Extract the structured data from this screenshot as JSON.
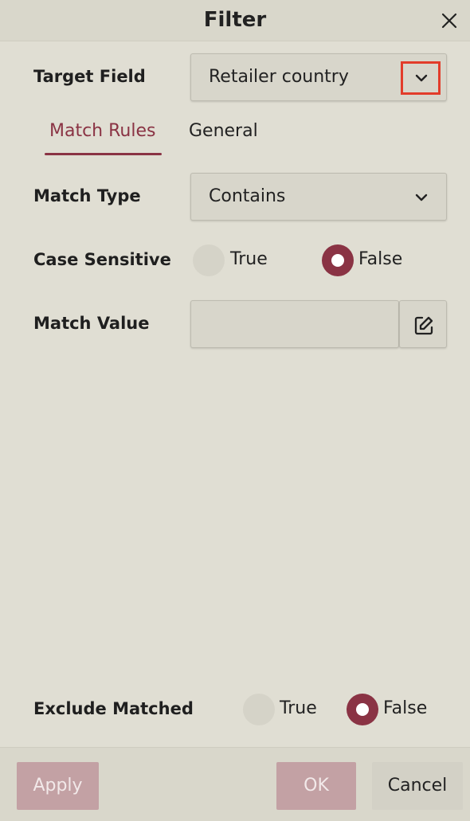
{
  "dialog": {
    "title": "Filter",
    "close_icon": "close-icon"
  },
  "target_field": {
    "label": "Target Field",
    "value": "Retailer country",
    "dropdown_icon": "chevron-down-icon"
  },
  "tabs": [
    {
      "label": "Match Rules",
      "active": true
    },
    {
      "label": "General",
      "active": false
    }
  ],
  "match_type": {
    "label": "Match Type",
    "value": "Contains",
    "dropdown_icon": "chevron-down-icon"
  },
  "case_sensitive": {
    "label": "Case Sensitive",
    "options": [
      {
        "label": "True",
        "selected": false
      },
      {
        "label": "False",
        "selected": true
      }
    ]
  },
  "match_value": {
    "label": "Match Value",
    "value": "",
    "edit_icon": "edit-icon"
  },
  "exclude_matched": {
    "label": "Exclude Matched",
    "options": [
      {
        "label": "True",
        "selected": false
      },
      {
        "label": "False",
        "selected": true
      }
    ]
  },
  "footer": {
    "apply_label": "Apply",
    "ok_label": "OK",
    "cancel_label": "Cancel"
  },
  "colors": {
    "accent": "#8a3344",
    "highlight": "#e23c2a",
    "background": "#e0ded3",
    "disabled_button": "#c3a1a4"
  }
}
